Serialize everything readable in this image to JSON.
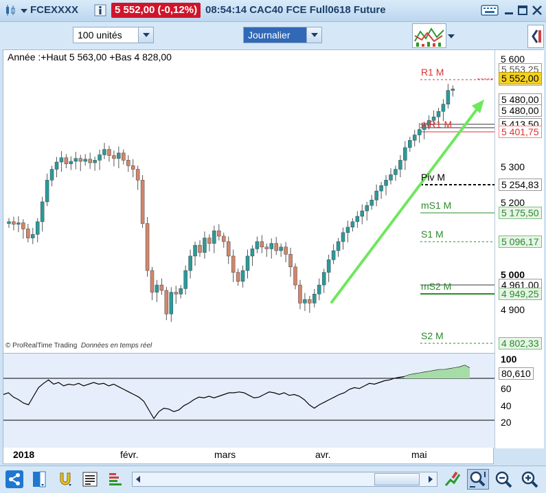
{
  "window": {
    "symbol": "FCEXXXX",
    "price_badge": "5 552,00 (-0,12%)",
    "info": "08:54:14 CAC40 FCE Full0618 Future"
  },
  "toolbar": {
    "units_select": "100 unités",
    "period_select": "Journalier"
  },
  "price_panel": {
    "info_label": "Année :+Haut 5 563,00 +Bas 4 828,00",
    "credit": "© ProRealTime Trading",
    "credit_italic": "Données en temps réel"
  },
  "pivots": [
    {
      "label": "R1 M",
      "value": "5 548,67",
      "color": "#e03030"
    },
    {
      "label": "mR1 M",
      "value": "5 401,75",
      "color": "#e03030"
    },
    {
      "label": "Piv M",
      "value": "5 254,83",
      "color": "#000000"
    },
    {
      "label": "mS1 M",
      "value": "5 175,50",
      "color": "#2a8a2a"
    },
    {
      "label": "S1 M",
      "value": "5 096,17",
      "color": "#2a8a2a"
    },
    {
      "label": "mS2 M",
      "value": "4 949,25",
      "color": "#2a8a2a"
    },
    {
      "label": "S2 M",
      "value": "4 802,33",
      "color": "#2a8a2a"
    }
  ],
  "price_axis": {
    "ticks": [
      "5 600",
      "5 300",
      "5 200",
      "5 000",
      "4 900"
    ],
    "current_price": "5 552,00",
    "boxes": [
      "5 553,25",
      "5 480,00",
      "5 480,00",
      "5 413,50",
      "4 961,00"
    ]
  },
  "oscillator": {
    "ticks": [
      "100",
      "60",
      "40",
      "20"
    ],
    "value": "80,610"
  },
  "dates": [
    "2018",
    "févr.",
    "mars",
    "avr.",
    "mai"
  ],
  "colors": {
    "bull": "#2a9a9a",
    "bear": "#d1866c",
    "trend_arrow": "#6ee85c"
  }
}
